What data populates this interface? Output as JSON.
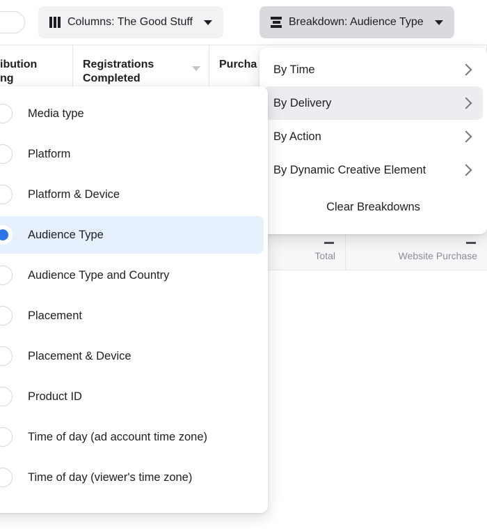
{
  "toolbar": {
    "toggle": {
      "name": "view-toggle",
      "state": "off"
    },
    "columns_button": {
      "label": "Columns: The Good Stuff",
      "icon": "columns-icon",
      "caret": "chevron-down-icon"
    },
    "breakdown_button": {
      "label": "Breakdown: Audience Type",
      "icon": "breakdown-icon",
      "caret": "chevron-down-icon",
      "active": true
    }
  },
  "table": {
    "headers": [
      "ibution\nng",
      "Registrations Completed",
      "Purcha"
    ],
    "header_col0_line1": "ibution",
    "header_col0_line2": "ng",
    "header_col1": "Registrations Completed",
    "header_col2": "Purcha",
    "metric_row": {
      "col0_value": "—",
      "col0_label": "Total",
      "col1_value": "—",
      "col1_label": "Website Purchase"
    }
  },
  "breakdown_menu": {
    "items": [
      {
        "label": "By Time",
        "has_submenu": true,
        "hovered": false
      },
      {
        "label": "By Delivery",
        "has_submenu": true,
        "hovered": true
      },
      {
        "label": "By Action",
        "has_submenu": true,
        "hovered": false
      },
      {
        "label": "By Dynamic Creative Element",
        "has_submenu": true,
        "hovered": false
      }
    ],
    "clear_label": "Clear Breakdowns"
  },
  "delivery_submenu": {
    "selected": "Audience Type",
    "options": [
      {
        "label": "Media type",
        "selected": false
      },
      {
        "label": "Platform",
        "selected": false
      },
      {
        "label": "Platform & Device",
        "selected": false
      },
      {
        "label": "Audience Type",
        "selected": true
      },
      {
        "label": "Audience Type and Country",
        "selected": false
      },
      {
        "label": "Placement",
        "selected": false
      },
      {
        "label": "Placement & Device",
        "selected": false
      },
      {
        "label": "Product ID",
        "selected": false
      },
      {
        "label": "Time of day (ad account time zone)",
        "selected": false
      },
      {
        "label": "Time of day (viewer's time zone)",
        "selected": false
      }
    ]
  },
  "colors": {
    "accent_blue": "#2c74e8",
    "selected_row_bg": "#e7f0fd",
    "button_bg": "#f1f2f3",
    "button_active_bg": "#d8dadd",
    "hover_bg": "#ebedf0",
    "text": "#1c1e21",
    "muted_text": "#8a8d91",
    "border": "#e4e6e9"
  }
}
